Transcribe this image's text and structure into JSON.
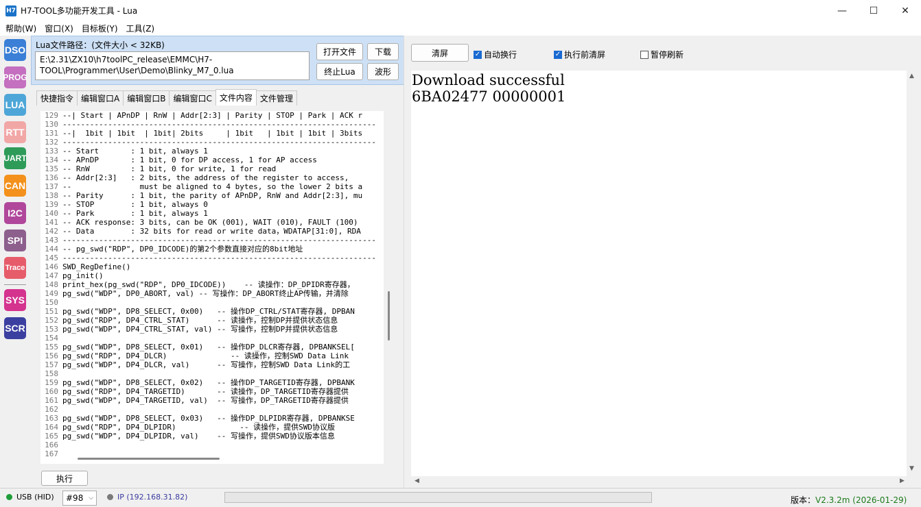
{
  "window": {
    "title": "H7-TOOL多功能开发工具 - Lua",
    "icon_text": "H7",
    "controls": [
      "—",
      "☐",
      "✕"
    ]
  },
  "menu": [
    "帮助(W)",
    "窗口(X)",
    "目标板(Y)",
    "工具(Z)"
  ],
  "sidebar": [
    {
      "label": "DSO",
      "color": "#3b7fd6"
    },
    {
      "label": "PROG",
      "color": "#c46fbf"
    },
    {
      "label": "LUA",
      "color": "#4ea6d8"
    },
    {
      "label": "RTT",
      "color": "#f2a7a7"
    },
    {
      "label": "UART",
      "color": "#2e9b59"
    },
    {
      "label": "CAN",
      "color": "#f3911c"
    },
    {
      "label": "I2C",
      "color": "#b0479b"
    },
    {
      "label": "SPI",
      "color": "#8c5f8c"
    },
    {
      "label": "Trace",
      "color": "#e65c6a"
    },
    {
      "label": "SYS",
      "color": "#d4338e"
    },
    {
      "label": "SCR",
      "color": "#3b3fa0"
    }
  ],
  "lua": {
    "path_label": "Lua文件路径：(文件大小 < 32KB)",
    "path_value": "E:\\2.31\\ZX10\\h7toolPC_release\\EMMC\\H7-TOOL\\Programmer\\User\\Demo\\Blinky_M7_0.lua",
    "open_file": "打开文件",
    "download": "下载",
    "stop": "终止Lua",
    "waveform": "波形"
  },
  "tabs": [
    "快捷指令",
    "编辑窗口A",
    "编辑窗口B",
    "编辑窗口C",
    "文件内容",
    "文件管理"
  ],
  "active_tab": "文件内容",
  "code": [
    {
      "n": "129",
      "t": "--| Start | APnDP | RnW | Addr[2:3] | Parity | STOP | Park | ACK r"
    },
    {
      "n": "130",
      "t": "---------------------------------------------------------------------"
    },
    {
      "n": "131",
      "t": "--|  1bit | 1bit  | 1bit| 2bits     | 1bit   | 1bit | 1bit | 3bits"
    },
    {
      "n": "132",
      "t": "---------------------------------------------------------------------"
    },
    {
      "n": "133",
      "t": "-- Start       : 1 bit, always 1"
    },
    {
      "n": "134",
      "t": "-- APnDP       : 1 bit, 0 for DP access, 1 for AP access"
    },
    {
      "n": "135",
      "t": "-- RnW         : 1 bit, 0 for write, 1 for read"
    },
    {
      "n": "136",
      "t": "-- Addr[2:3]   : 2 bits, the address of the register to access,"
    },
    {
      "n": "137",
      "t": "--               must be aligned to 4 bytes, so the lower 2 bits a"
    },
    {
      "n": "138",
      "t": "-- Parity      : 1 bit, the parity of APnDP, RnW and Addr[2:3], mu"
    },
    {
      "n": "139",
      "t": "-- STOP        : 1 bit, always 0"
    },
    {
      "n": "140",
      "t": "-- Park        : 1 bit, always 1"
    },
    {
      "n": "141",
      "t": "-- ACK response: 3 bits, can be OK (001), WAIT (010), FAULT (100)"
    },
    {
      "n": "142",
      "t": "-- Data        : 32 bits for read or write data，WDATAP[31:0], RDA"
    },
    {
      "n": "143",
      "t": "---------------------------------------------------------------------"
    },
    {
      "n": "144",
      "t": "-- pg_swd(\"RDP\", DP0_IDCODE)的第2个参数直接对应的8bit地址"
    },
    {
      "n": "145",
      "t": "---------------------------------------------------------------------"
    },
    {
      "n": "146",
      "t": "SWD_RegDefine()"
    },
    {
      "n": "147",
      "t": "pg_init()"
    },
    {
      "n": "148",
      "t": "print_hex(pg_swd(\"RDP\", DP0_IDCODE))    -- 读操作：DP_DPIDR寄存器，"
    },
    {
      "n": "149",
      "t": "pg_swd(\"WDP\", DP0_ABORT, val) -- 写操作：DP_ABORT终止AP传输，并清除"
    },
    {
      "n": "150",
      "t": ""
    },
    {
      "n": "151",
      "t": "pg_swd(\"WDP\", DP8_SELECT, 0x00)   -- 操作DP_CTRL/STAT寄存器, DPBAN"
    },
    {
      "n": "152",
      "t": "pg_swd(\"RDP\", DP4_CTRL_STAT)      -- 读操作，控制DP并提供状态信息"
    },
    {
      "n": "153",
      "t": "pg_swd(\"WDP\", DP4_CTRL_STAT, val) -- 写操作，控制DP并提供状态信息"
    },
    {
      "n": "154",
      "t": ""
    },
    {
      "n": "155",
      "t": "pg_swd(\"WDP\", DP8_SELECT, 0x01)   -- 操作DP_DLCR寄存器, DPBANKSEL["
    },
    {
      "n": "156",
      "t": "pg_swd(\"RDP\", DP4_DLCR)              -- 读操作，控制SWD Data Link"
    },
    {
      "n": "157",
      "t": "pg_swd(\"WDP\", DP4_DLCR, val)      -- 写操作，控制SWD Data Link的工"
    },
    {
      "n": "158",
      "t": ""
    },
    {
      "n": "159",
      "t": "pg_swd(\"WDP\", DP8_SELECT, 0x02)   -- 操作DP_TARGETID寄存器, DPBANK"
    },
    {
      "n": "160",
      "t": "pg_swd(\"RDP\", DP4_TARGETID)       -- 读操作，DP_TARGETID寄存器提供"
    },
    {
      "n": "161",
      "t": "pg_swd(\"WDP\", DP4_TARGETID, val)  -- 写操作，DP_TARGETID寄存器提供"
    },
    {
      "n": "162",
      "t": ""
    },
    {
      "n": "163",
      "t": "pg_swd(\"WDP\", DP8_SELECT, 0x03)   -- 操作DP_DLPIDR寄存器, DPBANKSE"
    },
    {
      "n": "164",
      "t": "pg_swd(\"RDP\", DP4_DLPIDR)              -- 读操作，提供SWD协议版"
    },
    {
      "n": "165",
      "t": "pg_swd(\"WDP\", DP4_DLPIDR, val)    -- 写操作，提供SWD协议版本信息"
    },
    {
      "n": "166",
      "t": ""
    },
    {
      "n": "167",
      "t": ""
    }
  ],
  "execute": "执行",
  "right": {
    "clear": "清屏",
    "auto_wrap": "自动换行",
    "clear_before": "执行前清屏",
    "pause": "暂停刷新",
    "auto_wrap_checked": true,
    "clear_before_checked": true,
    "pause_checked": false,
    "output": [
      "Download successful",
      "6BA02477 00000001"
    ]
  },
  "status": {
    "usb": "USB (HID)",
    "usb_color": "#1e9e3a",
    "device": "#98",
    "ip": "IP (192.168.31.82)",
    "ip_color": "#7a7a7a",
    "version_label": "版本：",
    "version": "V2.3.2m (2026-01-29)"
  }
}
